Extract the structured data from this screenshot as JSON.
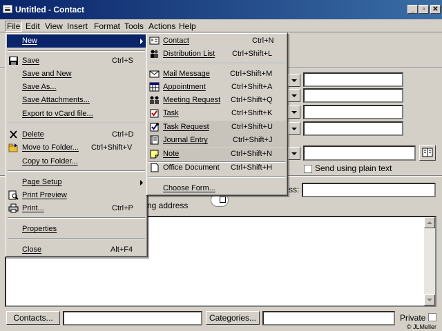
{
  "window": {
    "title": "Untitled - Contact",
    "controls": {
      "minimize": "_",
      "restore": "▫",
      "close": "✕"
    }
  },
  "menubar": {
    "items": [
      "File",
      "Edit",
      "View",
      "Insert",
      "Format",
      "Tools",
      "Actions",
      "Help"
    ],
    "active": "File"
  },
  "file_menu": {
    "new": {
      "label": "New",
      "highlighted": true
    },
    "save": {
      "label": "Save",
      "shortcut": "Ctrl+S"
    },
    "save_and_new": {
      "label": "Save and New"
    },
    "save_as": {
      "label": "Save As..."
    },
    "save_attachments": {
      "label": "Save Attachments..."
    },
    "export_vcard": {
      "label": "Export to vCard file..."
    },
    "delete": {
      "label": "Delete",
      "shortcut": "Ctrl+D"
    },
    "move_to_folder": {
      "label": "Move to Folder...",
      "shortcut": "Ctrl+Shift+V"
    },
    "copy_to_folder": {
      "label": "Copy to Folder..."
    },
    "page_setup": {
      "label": "Page Setup"
    },
    "print_preview": {
      "label": "Print Preview"
    },
    "print": {
      "label": "Print...",
      "shortcut": "Ctrl+P"
    },
    "properties": {
      "label": "Properties"
    },
    "close": {
      "label": "Close",
      "shortcut": "Alt+F4"
    }
  },
  "new_submenu": {
    "contact": {
      "label": "Contact",
      "shortcut": "Ctrl+N"
    },
    "distribution_list": {
      "label": "Distribution List",
      "shortcut": "Ctrl+Shift+L"
    },
    "mail_message": {
      "label": "Mail Message",
      "shortcut": "Ctrl+Shift+M"
    },
    "appointment": {
      "label": "Appointment",
      "shortcut": "Ctrl+Shift+A"
    },
    "meeting_request": {
      "label": "Meeting Request",
      "shortcut": "Ctrl+Shift+Q"
    },
    "task": {
      "label": "Task",
      "shortcut": "Ctrl+Shift+K"
    },
    "task_request": {
      "label": "Task Request",
      "shortcut": "Ctrl+Shift+U"
    },
    "journal_entry": {
      "label": "Journal Entry",
      "shortcut": "Ctrl+Shift+J"
    },
    "note": {
      "label": "Note",
      "shortcut": "Ctrl+Shift+N"
    },
    "office_document": {
      "label": "Office Document",
      "shortcut": "Ctrl+Shift+H"
    },
    "choose_form": {
      "label": "Choose Form..."
    }
  },
  "form": {
    "send_plain_text": "Send using plain text",
    "address_label_fragment": "ss:",
    "mailing_address_fragment": "ng address",
    "contacts_button": "Contacts...",
    "categories_button": "Categories...",
    "private_label": "Private"
  },
  "watermark": "© JLMeller"
}
